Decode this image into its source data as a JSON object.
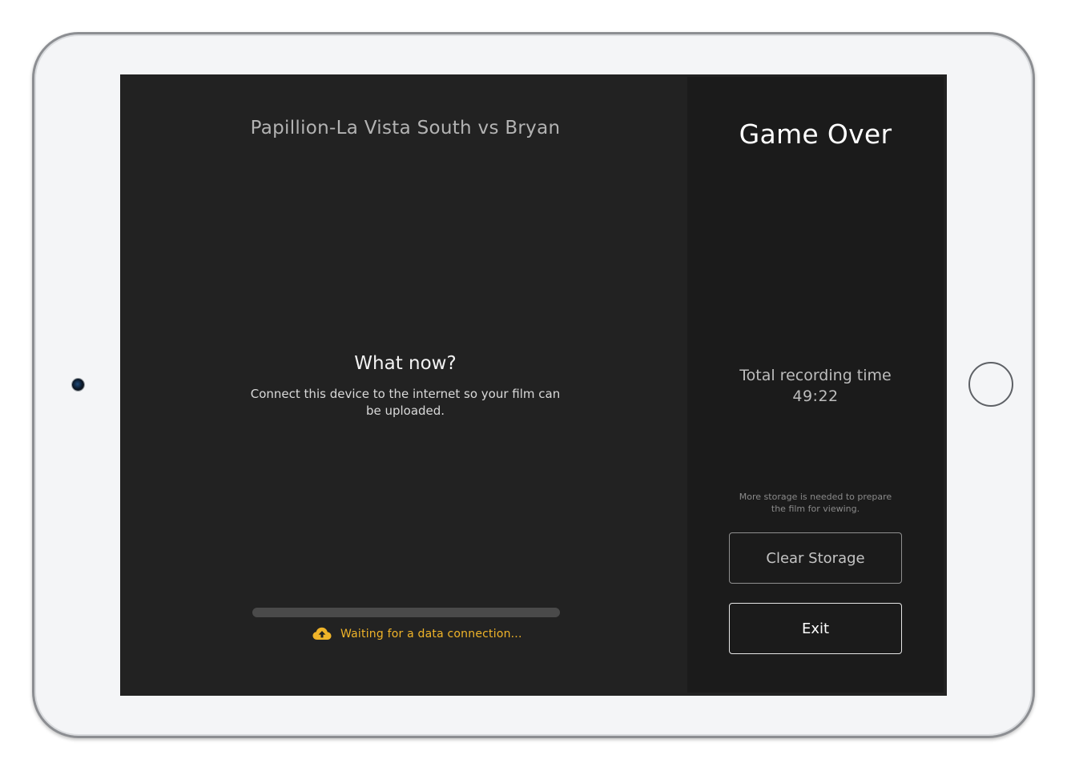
{
  "game": {
    "title": "Papillion-La Vista South vs Bryan"
  },
  "prompt": {
    "title": "What now?",
    "body": "Connect this device to the internet so your film can be uploaded."
  },
  "upload": {
    "progress": 0,
    "status_text": "Waiting for a data connection...",
    "status_color": "#f0b429",
    "status_icon": "cloud-upload-icon"
  },
  "summary": {
    "title": "Game Over",
    "recording_label": "Total recording time",
    "recording_time": "49:22",
    "storage_note": "More storage is needed to prepare the film for viewing."
  },
  "actions": {
    "clear_storage_label": "Clear Storage",
    "exit_label": "Exit"
  }
}
